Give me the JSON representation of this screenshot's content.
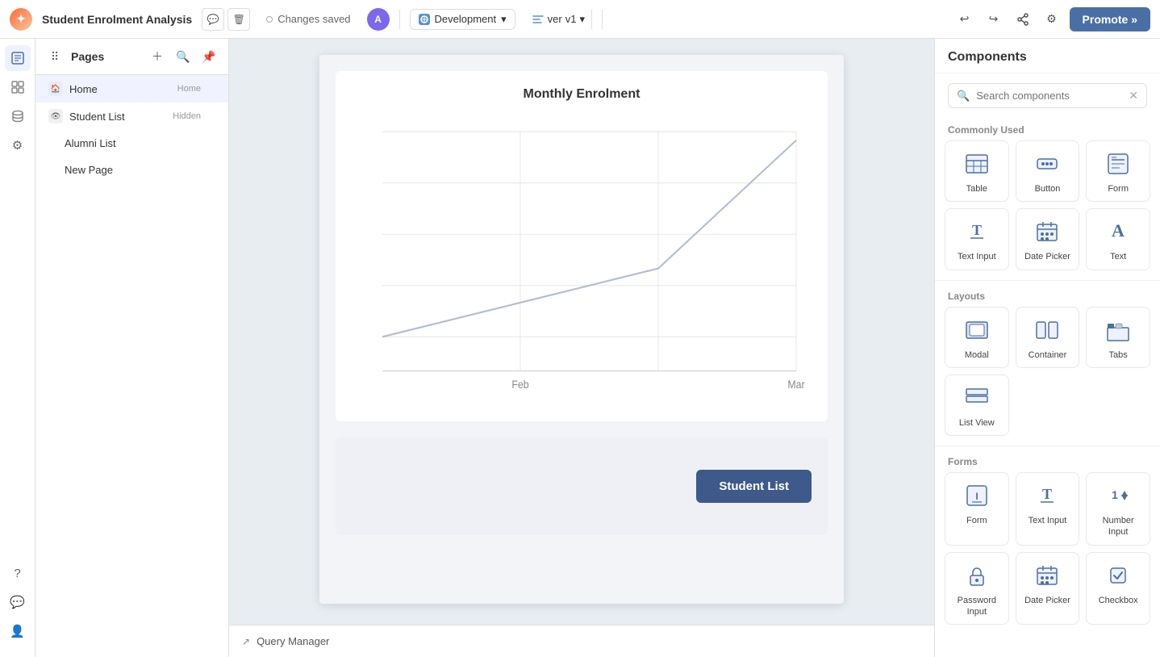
{
  "app": {
    "title": "Student Enrolment Analysis",
    "status": "Changes saved",
    "avatar": "A",
    "env_label": "Development",
    "ver_label": "ver",
    "ver_number": "v1",
    "promote_label": "Promote »"
  },
  "pages": {
    "title": "Pages",
    "items": [
      {
        "name": "Home",
        "badge": "Home",
        "level": 0,
        "active": true
      },
      {
        "name": "Student List",
        "badge": "Hidden",
        "level": 0,
        "active": false
      },
      {
        "name": "Alumni List",
        "badge": "",
        "level": 1,
        "active": false
      },
      {
        "name": "New Page",
        "badge": "",
        "level": 1,
        "active": false
      }
    ]
  },
  "canvas": {
    "chart_title": "Monthly Enrolment",
    "x_labels": [
      "Feb",
      "Mar"
    ],
    "button_label": "Student List"
  },
  "query_manager": {
    "label": "Query Manager"
  },
  "components": {
    "panel_title": "Components",
    "search_placeholder": "Search components",
    "sections": [
      {
        "label": "Commonly Used",
        "items": [
          {
            "id": "table",
            "label": "Table",
            "icon": "table-icon"
          },
          {
            "id": "button",
            "label": "Button",
            "icon": "button-icon"
          },
          {
            "id": "form",
            "label": "Form",
            "icon": "form-icon"
          },
          {
            "id": "text-input",
            "label": "Text Input",
            "icon": "text-input-icon"
          },
          {
            "id": "date-picker",
            "label": "Date Picker",
            "icon": "date-picker-icon"
          },
          {
            "id": "text",
            "label": "Text",
            "icon": "text-icon"
          }
        ]
      },
      {
        "label": "Layouts",
        "items": [
          {
            "id": "modal",
            "label": "Modal",
            "icon": "modal-icon"
          },
          {
            "id": "container",
            "label": "Container",
            "icon": "container-icon"
          },
          {
            "id": "tabs",
            "label": "Tabs",
            "icon": "tabs-icon"
          },
          {
            "id": "list-view",
            "label": "List View",
            "icon": "list-view-icon"
          }
        ]
      },
      {
        "label": "Forms",
        "items": [
          {
            "id": "form2",
            "label": "Form",
            "icon": "form2-icon"
          },
          {
            "id": "text-input2",
            "label": "Text Input",
            "icon": "text-input2-icon"
          },
          {
            "id": "number-input",
            "label": "Number Input",
            "icon": "number-input-icon"
          },
          {
            "id": "password-input",
            "label": "Password Input",
            "icon": "password-input-icon"
          },
          {
            "id": "date-picker2",
            "label": "Date Picker",
            "icon": "date-picker2-icon"
          },
          {
            "id": "checkbox",
            "label": "Checkbox",
            "icon": "checkbox-icon"
          }
        ]
      }
    ]
  }
}
